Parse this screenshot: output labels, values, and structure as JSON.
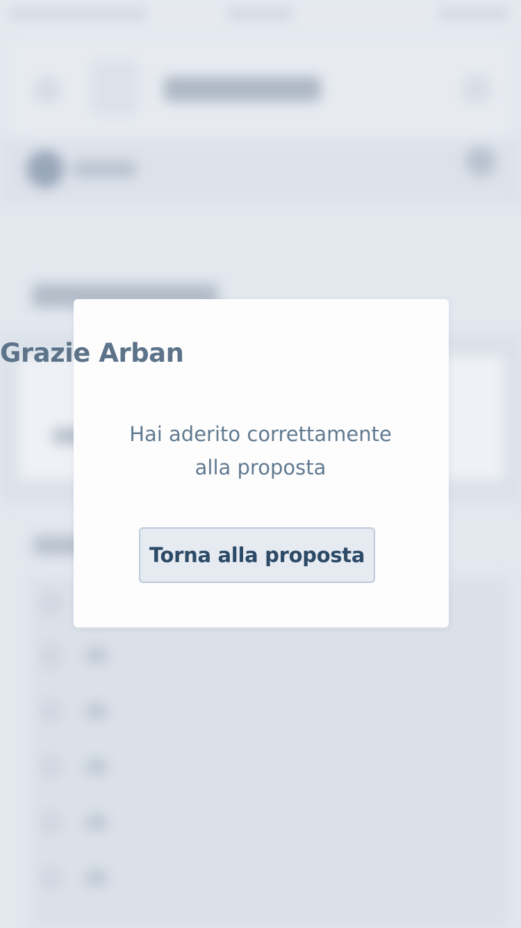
{
  "dialog": {
    "title": "Grazie Arban",
    "message": "Hai aderito correttamente alla proposta",
    "button_label": "Torna alla proposta"
  },
  "colors": {
    "background": "#e3e8ef",
    "dialog_background": "#fdfdfe",
    "title_text": "#5c7389",
    "message_text": "#617a90",
    "button_text": "#2d4a66",
    "button_background": "#e6ebf2",
    "button_border": "#bccadb"
  }
}
